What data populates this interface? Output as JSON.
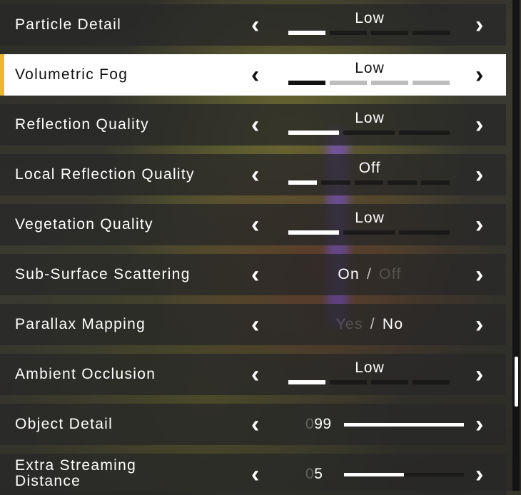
{
  "settings": [
    {
      "label": "Particle Detail",
      "type": "levels",
      "value": "Low",
      "filled": 1,
      "total": 4,
      "selected": false
    },
    {
      "label": "Volumetric Fog",
      "type": "levels",
      "value": "Low",
      "filled": 1,
      "total": 4,
      "selected": true
    },
    {
      "label": "Reflection Quality",
      "type": "levels",
      "value": "Low",
      "filled": 1,
      "total": 3,
      "selected": false
    },
    {
      "label": "Local Reflection Quality",
      "type": "levels",
      "value": "Off",
      "filled": 1,
      "total": 5,
      "selected": false
    },
    {
      "label": "Vegetation Quality",
      "type": "levels",
      "value": "Low",
      "filled": 1,
      "total": 3,
      "selected": false
    },
    {
      "label": "Sub-Surface Scattering",
      "type": "toggle",
      "option_a": "On",
      "separator": "/",
      "option_b": "Off",
      "active": "a",
      "selected": false
    },
    {
      "label": "Parallax Mapping",
      "type": "toggle",
      "option_a": "Yes",
      "separator": "/",
      "option_b": "No",
      "active": "b",
      "selected": false
    },
    {
      "label": "Ambient Occlusion",
      "type": "levels",
      "value": "Low",
      "filled": 1,
      "total": 4,
      "selected": false
    },
    {
      "label": "Object Detail",
      "type": "slider",
      "value": "099",
      "fraction": 1.0,
      "selected": false
    },
    {
      "label": "Extra Streaming Distance",
      "type": "slider",
      "value": "05",
      "fraction": 0.5,
      "selected": false
    }
  ],
  "icons": {
    "left": "chevron-left-icon",
    "right": "chevron-right-icon"
  },
  "colors": {
    "accent": "#e8b830",
    "row_bg": "#282828",
    "selected_bg": "#ffffff"
  },
  "scrollbar": {
    "position": 0.78
  }
}
